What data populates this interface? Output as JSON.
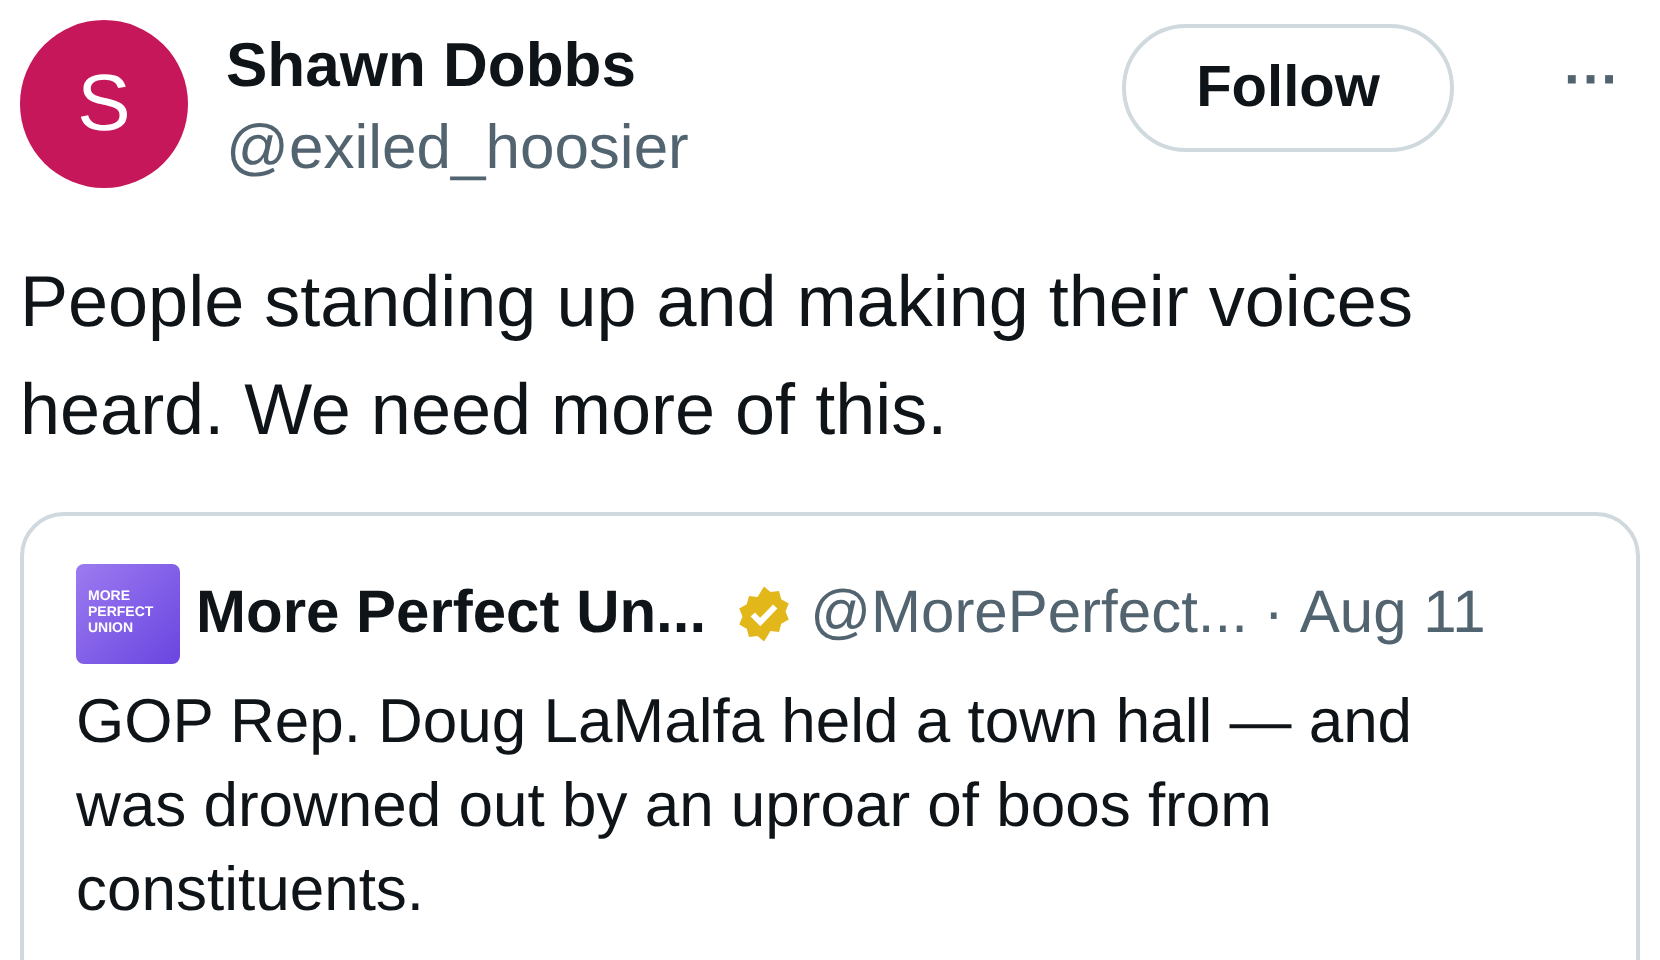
{
  "author": {
    "avatar_letter": "S",
    "name": "Shawn Dobbs",
    "handle": "@exiled_hoosier"
  },
  "follow_button": {
    "label": "Follow"
  },
  "more_button": {
    "label": "···"
  },
  "text": "People standing up and making their voices heard. We need more of this.",
  "quoted": {
    "logo_text": "MORE PERFECT UNION",
    "name": "More Perfect Un...",
    "verified": true,
    "handle": "@MorePerfect...",
    "separator": "·",
    "date": "Aug 11",
    "text": "GOP Rep. Doug LaMalfa held a town hall — and was drowned out by an uproar of boos from constituents."
  }
}
